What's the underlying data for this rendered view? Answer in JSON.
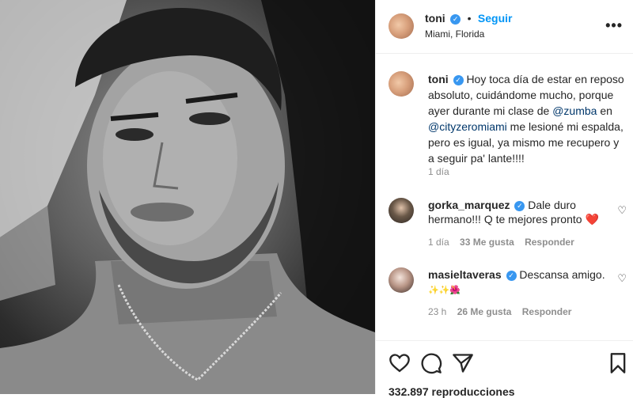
{
  "post": {
    "image_alt_description": "",
    "author": {
      "username": "toni",
      "follow_label": "Seguir",
      "separator": "•",
      "location": "Miami, Florida"
    },
    "more_label": "•••",
    "caption": {
      "username": "toni",
      "text_1": "Hoy toca día de estar en reposo absoluto, cuidándome mucho, porque ayer durante mi clase de ",
      "mention_1": "@zumba",
      "text_2": " en ",
      "mention_2": "@cityzeromiami",
      "text_3": " me lesioné mi espalda, pero es igual, ya mismo me recupero y a seguir pa' lante!!!!",
      "time": "1 día"
    },
    "comments": [
      {
        "username": "gorka_marquez",
        "text": "Dale duro hermano!!! Q te mejores pronto",
        "emoji": "❤️",
        "time": "1 día",
        "likes": "33 Me gusta",
        "reply_label": "Responder"
      },
      {
        "username": "masieltaveras",
        "text": "Descansa amigo.",
        "emoji": "✨✨🌺",
        "time": "23 h",
        "likes": "26 Me gusta",
        "reply_label": "Responder"
      }
    ],
    "views": "332.897 reproducciones"
  }
}
